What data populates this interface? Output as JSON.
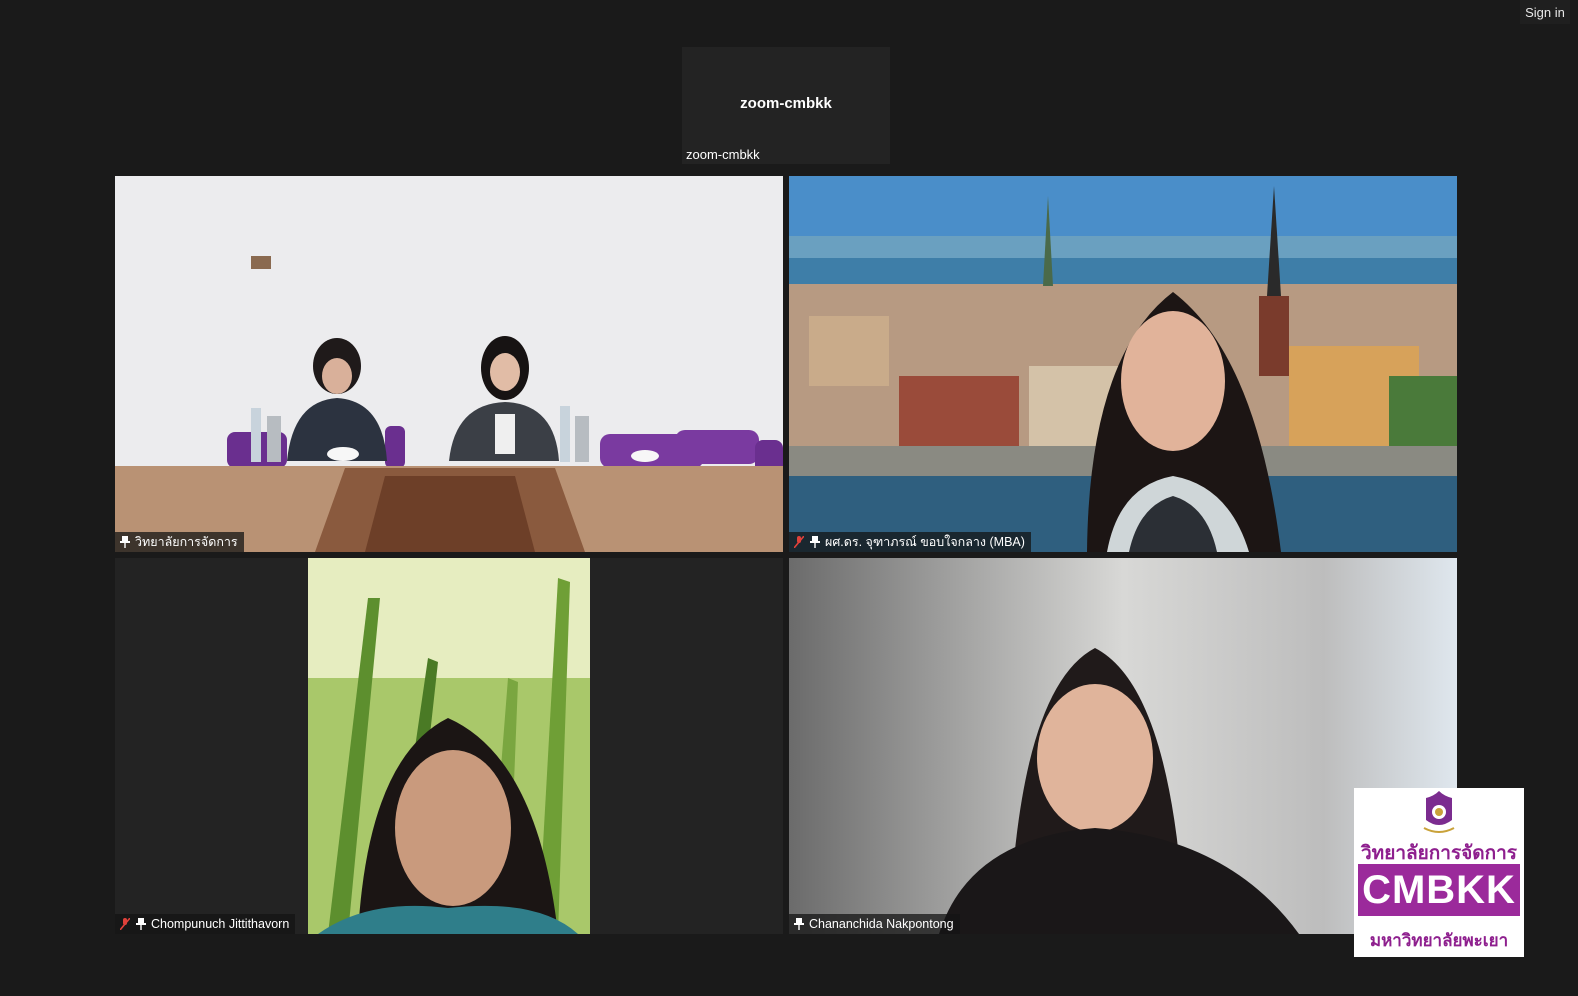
{
  "header": {
    "sign_in_label": "Sign in"
  },
  "top_tile": {
    "center_name": "zoom-cmbkk",
    "corner_name": "zoom-cmbkk"
  },
  "participants": [
    {
      "name": "วิทยาลัยการจัดการ",
      "muted": false,
      "pinned": true
    },
    {
      "name": "ผศ.ดร. จุฑาภรณ์ ขอบใจกลาง (MBA)",
      "muted": true,
      "pinned": true
    },
    {
      "name": "Chompunuch Jittithavorn",
      "muted": true,
      "pinned": true
    },
    {
      "name": "Chananchida Nakpontong",
      "muted": false,
      "pinned": true
    }
  ],
  "icons": {
    "muted": "mic-off-icon",
    "pinned": "pin-icon"
  },
  "logo": {
    "thai_top": "วิทยาลัยการจัดการ",
    "brand": "CMBKK",
    "thai_bottom": "มหาวิทยาลัยพะเยา",
    "brand_color": "#9b2a9b"
  },
  "colors": {
    "background": "#1a1a1a",
    "muted_icon": "#e0413a"
  }
}
